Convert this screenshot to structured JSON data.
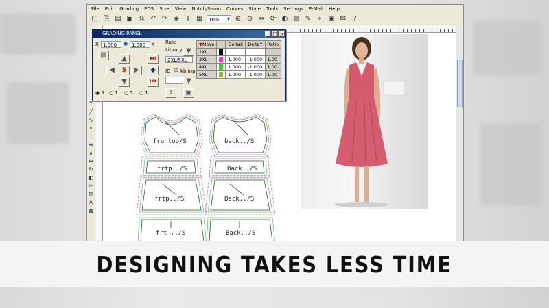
{
  "menu": [
    "File",
    "Edit",
    "Grading",
    "PDS",
    "Size",
    "View",
    "Notch/Seam",
    "Curves",
    "Style",
    "Tools",
    "Settings",
    "E-Mail",
    "Help"
  ],
  "toolbar": {
    "zoom_value": "10%"
  },
  "toolbar_icons": [
    "new-icon",
    "open-icon",
    "grading-icon",
    "save-icon",
    "print-icon",
    "undo-icon",
    "redo-icon",
    "layer-icon",
    "text-icon",
    "grid-icon",
    "zoom-select",
    "zoom-in-icon",
    "zoom-out-icon",
    "flip-icon",
    "rotate-icon",
    "mirror-icon",
    "image-icon",
    "edit-icon",
    "measure-icon",
    "camera-icon",
    "email-icon",
    "help-icon"
  ],
  "panel": {
    "title": "GRADING PANEL",
    "x_label": "X",
    "x_value": "1.000",
    "y_value": "1.000",
    "y_label": "Y",
    "rule_label": "Rule",
    "library_label": "Library",
    "rule_value": "2XL/5XL",
    "id_label": "ID",
    "kb_label": "kb input",
    "a_button": "A",
    "center_value": "5",
    "radio_labels": [
      "5",
      "1",
      "5",
      "1"
    ],
    "table": {
      "headers": [
        "Move",
        "DeltaX",
        "DeltaY",
        "Ratio"
      ],
      "rows": [
        {
          "size": "2XL",
          "color": "#000000",
          "dx": "",
          "dy": "",
          "ratio": ""
        },
        {
          "size": "3XL",
          "color": "#ff33cc",
          "dx": "1.000",
          "dy": "-1.000",
          "ratio": "1.00"
        },
        {
          "size": "4XL",
          "color": "#33cc33",
          "dx": "1.000",
          "dy": "-1.000",
          "ratio": "1.00"
        },
        {
          "size": "5XL",
          "color": "#99aa33",
          "dx": "1.000",
          "dy": "-1.000",
          "ratio": "1.00"
        }
      ]
    }
  },
  "pieces": {
    "front_top": "frontop/S",
    "back_top": "back../S",
    "front_band": "frtp../S",
    "back_band": "Back../S",
    "front_mid": "frtp../S",
    "back_mid": "Back../S",
    "front_low": "frt ../S",
    "back_low": "Back../S"
  },
  "banner": {
    "text": "DESIGNING TAKES LESS TIME"
  }
}
